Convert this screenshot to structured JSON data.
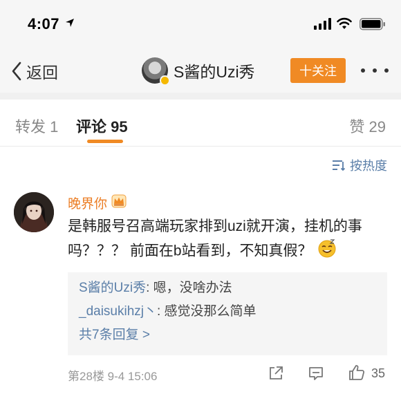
{
  "status_bar": {
    "time": "4:07"
  },
  "nav": {
    "back_label": "返回",
    "title": "S酱的Uzi秀",
    "follow_label": "十关注"
  },
  "tabs": {
    "repost": "转发 1",
    "comments": "评论 95",
    "likes": "赞 29"
  },
  "sort": {
    "label": "按热度"
  },
  "comment": {
    "username": "晚界你",
    "text": "是韩服号召高端玩家排到uzi就开演，挂机的事吗？？？ 前面在b站看到，不知真假？",
    "replies": [
      {
        "name": "S酱的Uzi秀",
        "text": ": 嗯，没啥办法"
      },
      {
        "name": "_daisukihzj丶",
        "text": ": 感觉没那么简单"
      }
    ],
    "more_replies": "共7条回复 >",
    "floor_time": "第28楼 9-4 15:06",
    "like_count": "35"
  },
  "colors": {
    "accent_orange": "#f08a24",
    "link_blue": "#5a7ea8",
    "username_orange": "#eb7d24"
  }
}
